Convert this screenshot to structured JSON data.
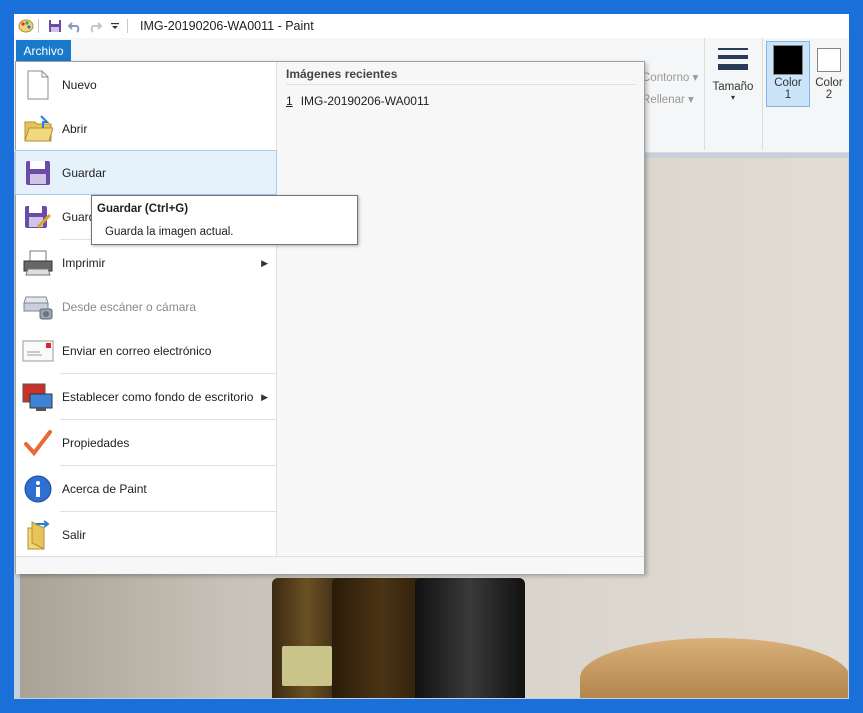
{
  "window": {
    "title": "IMG-20190206-WA0011 - Paint"
  },
  "quick_access": {
    "icons": [
      "paint-app-icon",
      "save-icon",
      "undo-icon",
      "redo-icon",
      "customize-dropdown-icon"
    ]
  },
  "ribbon": {
    "contorno_label": "Contorno",
    "rellenar_label": "Rellenar",
    "tamano_label": "Tamaño",
    "color1_label": "Color",
    "color1_num": "1",
    "color2_label": "Color",
    "color2_num": "2",
    "color1_value": "#000000",
    "color2_value": "#ffffff"
  },
  "file_tab": {
    "label": "Archivo"
  },
  "file_menu": {
    "items": [
      {
        "label": "Nuevo",
        "icon": "new-file-icon"
      },
      {
        "label": "Abrir",
        "icon": "open-folder-icon"
      },
      {
        "label": "Guardar",
        "icon": "save-icon"
      },
      {
        "label": "Guardar como",
        "icon": "save-as-icon"
      },
      {
        "label": "Imprimir",
        "icon": "printer-icon"
      },
      {
        "label": "Desde escáner o cámara",
        "icon": "scanner-icon"
      },
      {
        "label": "Enviar en correo electrónico",
        "icon": "email-icon"
      },
      {
        "label": "Establecer como fondo de escritorio",
        "icon": "desktop-background-icon"
      },
      {
        "label": "Propiedades",
        "icon": "checkmark-icon"
      },
      {
        "label": "Acerca de Paint",
        "icon": "info-icon"
      },
      {
        "label": "Salir",
        "icon": "exit-icon"
      }
    ],
    "recent_title": "Imágenes recientes",
    "recent_items": [
      {
        "index": "1",
        "name": "IMG-20190206-WA0011"
      }
    ]
  },
  "tooltip": {
    "title": "Guardar (Ctrl+G)",
    "body": "Guarda la imagen actual."
  }
}
